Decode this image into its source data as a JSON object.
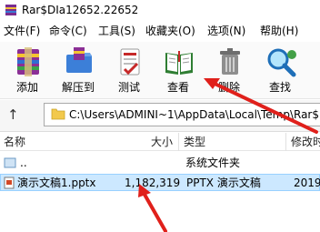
{
  "window": {
    "title": "Rar$DIa12652.22652"
  },
  "menu": [
    {
      "label": "文件(F)"
    },
    {
      "label": "命令(C)"
    },
    {
      "label": "工具(S)"
    },
    {
      "label": "收藏夹(O)"
    },
    {
      "label": "选项(N)"
    },
    {
      "label": "帮助(H)"
    }
  ],
  "toolbar": [
    {
      "label": "添加",
      "icon": "add-archive-icon"
    },
    {
      "label": "解压到",
      "icon": "extract-to-icon"
    },
    {
      "label": "测试",
      "icon": "test-icon"
    },
    {
      "label": "查看",
      "icon": "view-book-icon"
    },
    {
      "label": "删除",
      "icon": "delete-trash-icon"
    },
    {
      "label": "查找",
      "icon": "find-magnifier-icon"
    }
  ],
  "address": {
    "path": "C:\\Users\\ADMINI~1\\AppData\\Local\\Temp\\Rar$"
  },
  "columns": {
    "name": "名称",
    "size": "大小",
    "type": "类型",
    "modified": "修改时"
  },
  "rows": [
    {
      "name": "..",
      "size": "",
      "type": "系统文件夹",
      "modified": ""
    },
    {
      "name": "演示文稿1.pptx",
      "size": "1,182,319",
      "type": "PPTX 演示文稿",
      "modified": "2019"
    }
  ],
  "colors": {
    "selection": "#cce8ff",
    "selection_border": "#99d1ff",
    "annotation": "#e0201b"
  }
}
